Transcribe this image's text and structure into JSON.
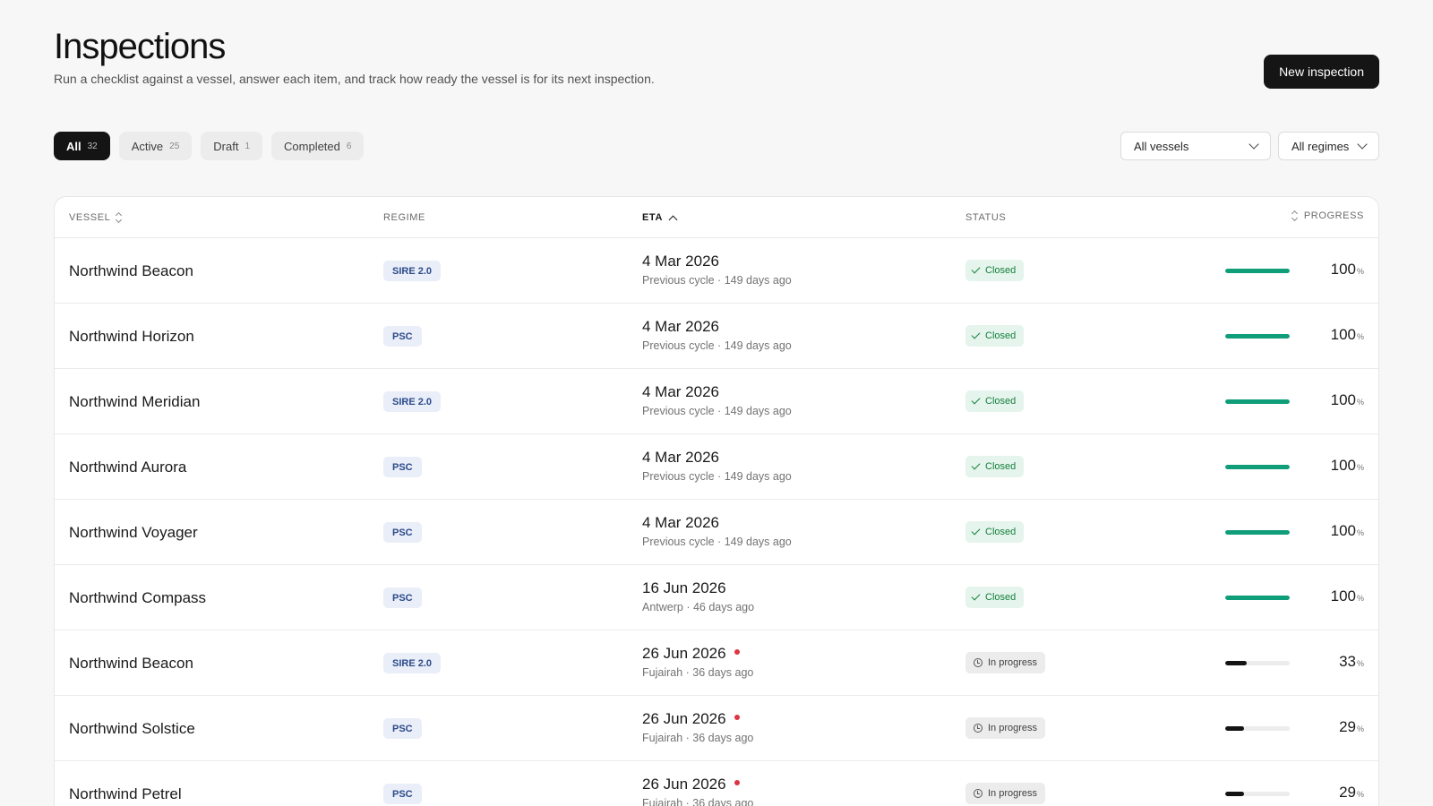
{
  "header": {
    "title": "Inspections",
    "subtitle": "Run a checklist against a vessel, answer each item, and track how ready the vessel is for its next inspection.",
    "new_button": "New inspection"
  },
  "filters": [
    {
      "label": "All",
      "count": "32",
      "active": true
    },
    {
      "label": "Active",
      "count": "25",
      "active": false
    },
    {
      "label": "Draft",
      "count": "1",
      "active": false
    },
    {
      "label": "Completed",
      "count": "6",
      "active": false
    }
  ],
  "selects": {
    "vessels": "All vessels",
    "regimes": "All regimes"
  },
  "columns": {
    "vessel": "VESSEL",
    "regime": "REGIME",
    "eta": "ETA",
    "status": "STATUS",
    "progress": "PROGRESS"
  },
  "colors": {
    "accent": "#151515",
    "progress_complete": "#0f9d7a",
    "progress_partial": "#141414",
    "late_dot": "#dc3545"
  },
  "rows": [
    {
      "vessel": "Northwind Beacon",
      "regime": "SIRE 2.0",
      "eta": "4 Mar 2026",
      "late": false,
      "sub": "Previous cycle · 149 days ago",
      "status": "Closed",
      "status_type": "closed",
      "progress": 100
    },
    {
      "vessel": "Northwind Horizon",
      "regime": "PSC",
      "eta": "4 Mar 2026",
      "late": false,
      "sub": "Previous cycle · 149 days ago",
      "status": "Closed",
      "status_type": "closed",
      "progress": 100
    },
    {
      "vessel": "Northwind Meridian",
      "regime": "SIRE 2.0",
      "eta": "4 Mar 2026",
      "late": false,
      "sub": "Previous cycle · 149 days ago",
      "status": "Closed",
      "status_type": "closed",
      "progress": 100
    },
    {
      "vessel": "Northwind Aurora",
      "regime": "PSC",
      "eta": "4 Mar 2026",
      "late": false,
      "sub": "Previous cycle · 149 days ago",
      "status": "Closed",
      "status_type": "closed",
      "progress": 100
    },
    {
      "vessel": "Northwind Voyager",
      "regime": "PSC",
      "eta": "4 Mar 2026",
      "late": false,
      "sub": "Previous cycle · 149 days ago",
      "status": "Closed",
      "status_type": "closed",
      "progress": 100
    },
    {
      "vessel": "Northwind Compass",
      "regime": "PSC",
      "eta": "16 Jun 2026",
      "late": false,
      "sub": "Antwerp · 46 days ago",
      "status": "Closed",
      "status_type": "closed",
      "progress": 100
    },
    {
      "vessel": "Northwind Beacon",
      "regime": "SIRE 2.0",
      "eta": "26 Jun 2026",
      "late": true,
      "sub": "Fujairah · 36 days ago",
      "status": "In progress",
      "status_type": "progress",
      "progress": 33
    },
    {
      "vessel": "Northwind Solstice",
      "regime": "PSC",
      "eta": "26 Jun 2026",
      "late": true,
      "sub": "Fujairah · 36 days ago",
      "status": "In progress",
      "status_type": "progress",
      "progress": 29
    },
    {
      "vessel": "Northwind Petrel",
      "regime": "PSC",
      "eta": "26 Jun 2026",
      "late": true,
      "sub": "Fujairah · 36 days ago",
      "status": "In progress",
      "status_type": "progress",
      "progress": 29
    }
  ],
  "percent_unit": "%"
}
